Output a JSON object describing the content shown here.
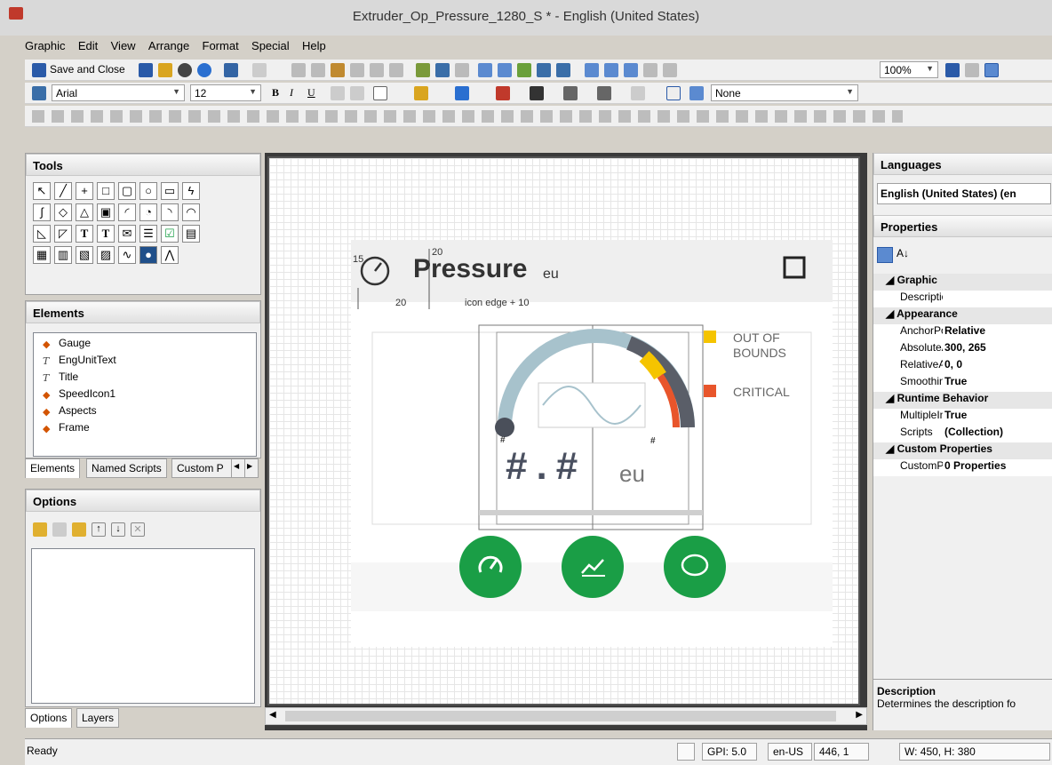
{
  "window": {
    "title": "Extruder_Op_Pressure_1280_S * - English (United States)"
  },
  "menu": [
    "Graphic",
    "Edit",
    "View",
    "Arrange",
    "Format",
    "Special",
    "Help"
  ],
  "toolbar": {
    "save_close": "Save and Close",
    "zoom": "100%",
    "font": "Arial",
    "size": "12",
    "line_style": "None"
  },
  "tools": {
    "header": "Tools"
  },
  "elements": {
    "header": "Elements",
    "items": [
      "Gauge",
      "EngUnitText",
      "Title",
      "SpeedIcon1",
      "Aspects",
      "Frame"
    ],
    "tabs": [
      "Elements",
      "Named Scripts",
      "Custom P"
    ]
  },
  "options": {
    "header": "Options"
  },
  "bottom_tabs": [
    "Options",
    "Layers"
  ],
  "canvas": {
    "title": "Pressure",
    "title_unit": "eu",
    "dim_15": "15",
    "dim_20_top": "20",
    "dim_20_left": "20",
    "icon_edge": "icon edge + 10",
    "value_placeholder": "#.#",
    "value_unit": "eu",
    "hash_small": "#",
    "legend_out": "OUT OF BOUNDS",
    "legend_critical": "CRITICAL",
    "colors": {
      "out": "#f5c400",
      "critical": "#e8552b",
      "button": "#1a9e46"
    }
  },
  "languages": {
    "header": "Languages",
    "selected": "English (United States) (en"
  },
  "properties": {
    "header": "Properties",
    "rows": [
      {
        "type": "cat",
        "k": "Graphic"
      },
      {
        "type": "row",
        "k": "Description",
        "v": ""
      },
      {
        "type": "cat",
        "k": "Appearance"
      },
      {
        "type": "row",
        "k": "AnchorPoint",
        "v": "Relative"
      },
      {
        "type": "row",
        "k": "AbsoluteAnchor",
        "v": "300, 265"
      },
      {
        "type": "row",
        "k": "RelativeAnchor",
        "v": "0, 0"
      },
      {
        "type": "row",
        "k": "Smoothing",
        "v": "True"
      },
      {
        "type": "cat",
        "k": "Runtime Behavior"
      },
      {
        "type": "row",
        "k": "MultipleInstances",
        "v": "True"
      },
      {
        "type": "row",
        "k": "Scripts",
        "v": "(Collection)"
      },
      {
        "type": "cat",
        "k": "Custom Properties"
      },
      {
        "type": "row",
        "k": "CustomProperties",
        "v": "0 Properties"
      }
    ]
  },
  "description": {
    "title": "Description",
    "text": "Determines the description fo"
  },
  "status": {
    "ready": "Ready",
    "gpi": "GPI: 5.0",
    "locale": "en-US",
    "pos": "446, 1",
    "size": "W: 450, H: 380"
  }
}
